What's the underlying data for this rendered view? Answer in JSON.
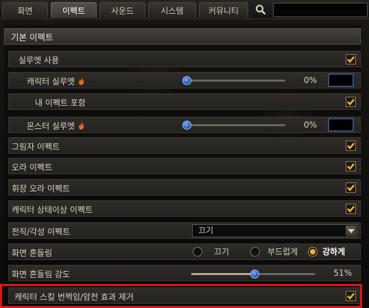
{
  "tabs": [
    {
      "label": "화면"
    },
    {
      "label": "이펙트"
    },
    {
      "label": "사운드"
    },
    {
      "label": "시스템"
    },
    {
      "label": "커뮤니티"
    }
  ],
  "search": {
    "value": "",
    "placeholder": ""
  },
  "section": {
    "title": "기본 이펙트"
  },
  "rows": {
    "silhouette": {
      "label": "실루엣 사용",
      "checked": true
    },
    "char_silhouette": {
      "label": "캐릭터 실루엣",
      "value_text": "0%",
      "value": 0
    },
    "my_effect": {
      "label": "내 이펙트 포함",
      "checked": true
    },
    "monster_silhouette": {
      "label": "몬스터 실루엣",
      "value_text": "0%",
      "value": 0
    },
    "shadow": {
      "label": "그림자 이펙트",
      "checked": true
    },
    "aura": {
      "label": "오라 이펙트",
      "checked": true
    },
    "banner_aura": {
      "label": "휘장 오라 이펙트",
      "checked": true
    },
    "status_effect": {
      "label": "캐릭터 상태이상 이펙트",
      "checked": true
    },
    "class_awaken": {
      "label": "전직/각성 이펙트",
      "select_value": "끄기"
    },
    "screen_shake": {
      "label": "화면 흔들림",
      "options": [
        "끄기",
        "부드럽게",
        "강하게"
      ],
      "selected": "강하게"
    },
    "shake_strength": {
      "label": "화면 흔들림 강도",
      "value_text": "51%",
      "value": 51
    },
    "skill_flash": {
      "label": "캐릭터 스킬 번쩍임/암전 효과 제거",
      "checked": true
    }
  },
  "colors": {
    "highlight": "#e01515",
    "check": "#f0b43a",
    "thumb": "#2a58b8"
  }
}
